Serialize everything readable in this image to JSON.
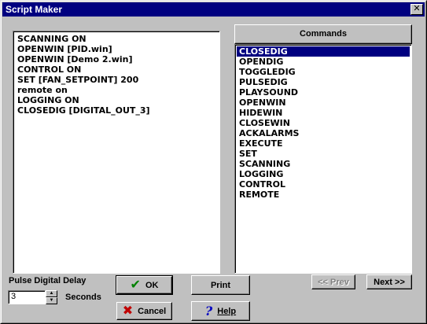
{
  "window": {
    "title": "Script Maker"
  },
  "script": {
    "lines": [
      "SCANNING ON",
      "OPENWIN [PID.win]",
      "OPENWIN [Demo 2.win]",
      "CONTROL ON",
      "SET [FAN_SETPOINT] 200",
      "remote on",
      "LOGGING ON",
      "CLOSEDIG [DIGITAL_OUT_3]"
    ]
  },
  "commands": {
    "header": "Commands",
    "selected_index": 0,
    "items": [
      "CLOSEDIG",
      "OPENDIG",
      "TOGGLEDIG",
      "PULSEDIG",
      "PLAYSOUND",
      "OPENWIN",
      "HIDEWIN",
      "CLOSEWIN",
      "ACKALARMS",
      "EXECUTE",
      "SET",
      "SCANNING",
      "LOGGING",
      "CONTROL",
      "REMOTE"
    ]
  },
  "pulse": {
    "label": "Pulse Digital Delay",
    "value": "3",
    "units": "Seconds"
  },
  "buttons": {
    "ok": "OK",
    "cancel": "Cancel",
    "print": "Print",
    "help": "Help",
    "prev": "<< Prev",
    "next": "Next >>"
  },
  "colors": {
    "titlebar": "#000080",
    "selection": "#000080",
    "ok_check": "#008000",
    "cancel_x": "#c00000",
    "help_icon": "#0000c0"
  }
}
